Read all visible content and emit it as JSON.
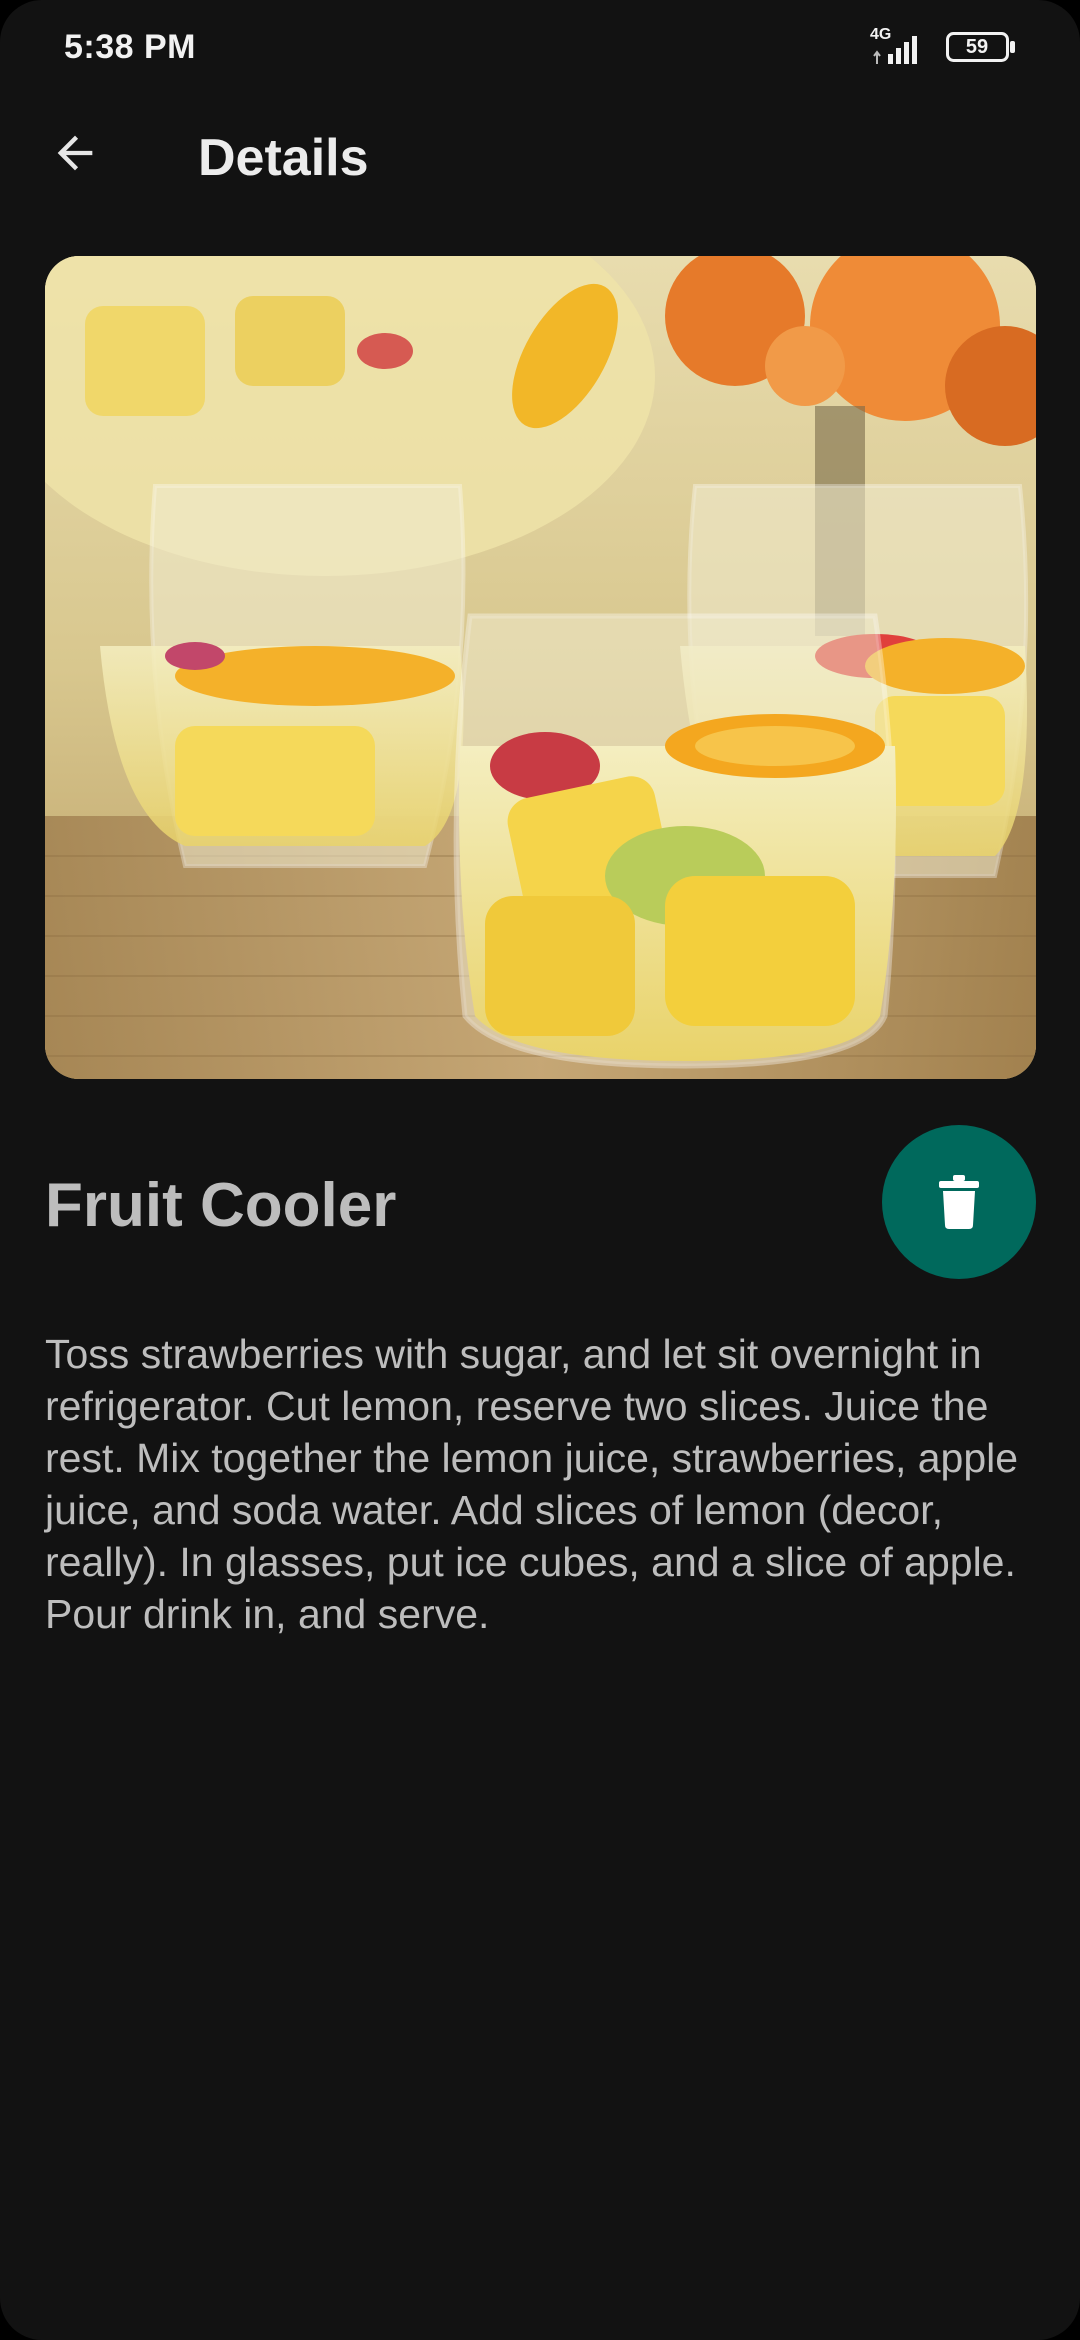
{
  "status_bar": {
    "time": "5:38 PM",
    "network": "4G",
    "battery": "59"
  },
  "app_bar": {
    "title": "Details",
    "back_icon": "arrow-back-icon"
  },
  "recipe": {
    "title": "Fruit Cooler",
    "description": "Toss strawberries with sugar, and let sit overnight in refrigerator. Cut lemon, reserve two slices. Juice the rest. Mix together the lemon juice, strawberries, apple juice, and soda water. Add slices of lemon (decor, really). In glasses, put ice cubes, and a slice of apple. Pour drink in, and serve.",
    "delete_icon": "trash-icon"
  },
  "colors": {
    "background": "#121212",
    "fab": "#00695c",
    "text_secondary": "#bdbdbd"
  }
}
